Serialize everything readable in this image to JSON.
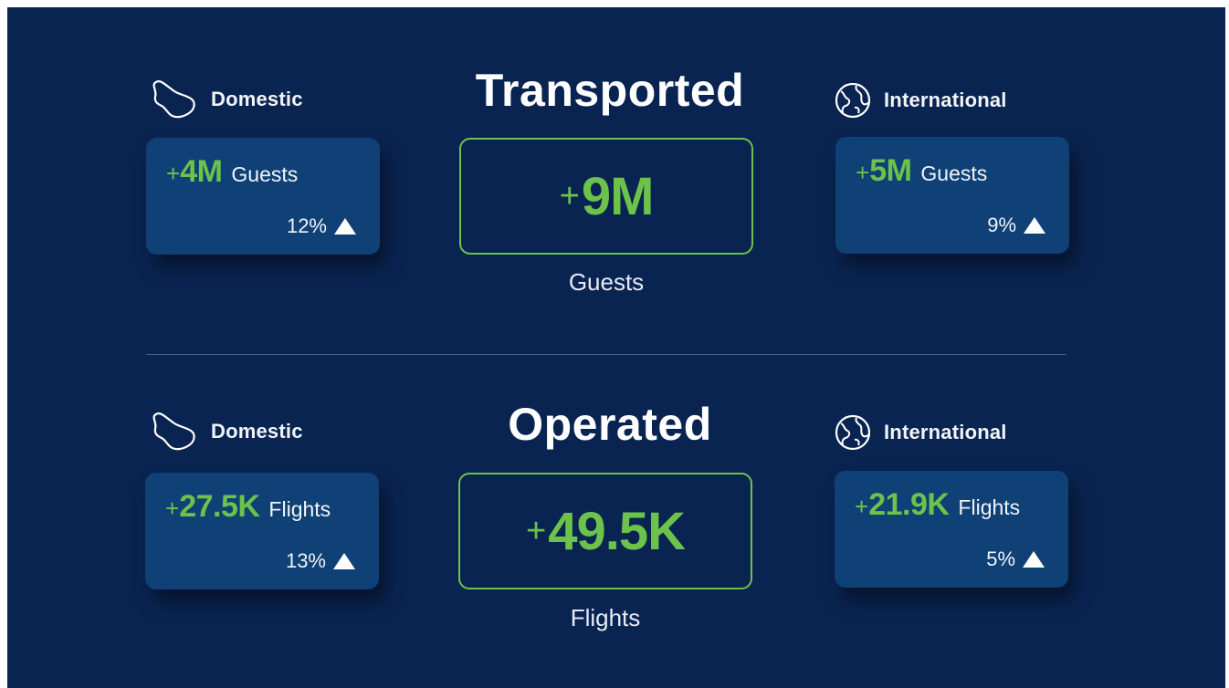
{
  "sections": [
    {
      "title": "Transported",
      "domestic": {
        "label": "Domestic",
        "plus": "+",
        "value": "4M",
        "unit": "Guests",
        "change": "12%"
      },
      "total": {
        "plus": "+",
        "value": "9M",
        "unit": "Guests"
      },
      "international": {
        "label": "International",
        "plus": "+",
        "value": "5M",
        "unit": "Guests",
        "change": "9%"
      }
    },
    {
      "title": "Operated",
      "domestic": {
        "label": "Domestic",
        "plus": "+",
        "value": "27.5K",
        "unit": "Flights",
        "change": "13%"
      },
      "total": {
        "plus": "+",
        "value": "49.5K",
        "unit": "Flights"
      },
      "international": {
        "label": "International",
        "plus": "+",
        "value": "21.9K",
        "unit": "Flights",
        "change": "5%"
      }
    }
  ],
  "colors": {
    "background": "#0a2452",
    "card": "#0f4177",
    "accent_green": "#6cc24a",
    "text": "#f1f4f8",
    "divider": "#3f6a76"
  },
  "icons": {
    "domestic": "country-outline-icon",
    "international": "globe-icon",
    "change": "triangle-up-icon"
  }
}
